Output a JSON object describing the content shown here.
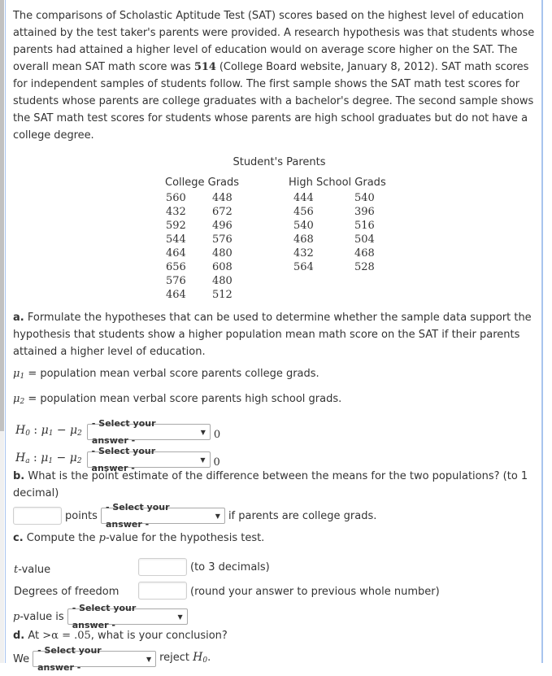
{
  "intro": {
    "before_number": "The comparisons of Scholastic Aptitude Test (SAT) scores based on the highest level of education attained by the test taker's parents were provided. A research hypothesis was that students whose parents had attained a higher level of education would on average score higher on the SAT. The overall mean SAT math score was ",
    "overall_mean": "514",
    "after_number": " (College Board website, January 8, 2012). SAT math scores for independent samples of students follow. The first sample shows the SAT math test scores for students whose parents are college graduates with a bachelor's degree. The second sample shows the SAT math test scores for students whose parents are high school graduates but do not have a college degree."
  },
  "table": {
    "title": "Student's Parents",
    "college": {
      "header": "College Grads",
      "col1": [
        "560",
        "432",
        "592",
        "544",
        "464",
        "656",
        "576",
        "464"
      ],
      "col2": [
        "448",
        "672",
        "496",
        "576",
        "480",
        "608",
        "480",
        "512"
      ]
    },
    "high_school": {
      "header": "High School Grads",
      "col1": [
        "444",
        "456",
        "540",
        "468",
        "432",
        "564"
      ],
      "col2": [
        "540",
        "396",
        "516",
        "504",
        "468",
        "528"
      ]
    }
  },
  "part_a": {
    "label": "a.",
    "text": " Formulate the hypotheses that can be used to determine whether the sample data support the hypothesis that students show a higher population mean math score on the SAT if their parents attained a higher level of education.",
    "mu1_def": "= population mean verbal score parents college grads.",
    "mu2_def": "= population mean verbal score parents high school grads.",
    "h0_prefix": "H",
    "h0_sub": "0",
    "ha_prefix": "H",
    "ha_sub": "a",
    "expr": ": μ",
    "minus": " − μ",
    "h0_select": "- Select your answer -",
    "ha_select": "- Select your answer -",
    "h0_rhs": "0",
    "ha_rhs": "0"
  },
  "part_b": {
    "label": "b.",
    "text": " What is the point estimate of the difference between the means for the two populations? (to 1 decimal)",
    "input_value": "",
    "points_label": "points",
    "select": "- Select your answer -",
    "suffix": "if parents are college grads."
  },
  "part_c": {
    "label": "c.",
    "text_before": " Compute the ",
    "p": "p",
    "text_after": "-value for the hypothesis test.",
    "t_label_var": "t",
    "t_label_rest": "-value",
    "t_value": "",
    "t_hint": "(to 3 decimals)",
    "df_label": "Degrees of freedom",
    "df_value": "",
    "df_hint": "(round your answer to previous whole number)",
    "pvalue_var": "p",
    "pvalue_rest": "-value is",
    "pvalue_select": "- Select your answer -"
  },
  "part_d": {
    "label": "d.",
    "text_before": " At ",
    "alpha_expr": ">α = .05",
    "text_after": ", what is your conclusion?",
    "we_label": "We",
    "select": "- Select your answer -",
    "reject_text": "reject ",
    "h_var": "H",
    "h_sub": "0",
    "period": "."
  },
  "select_arrow_icon": "▼"
}
